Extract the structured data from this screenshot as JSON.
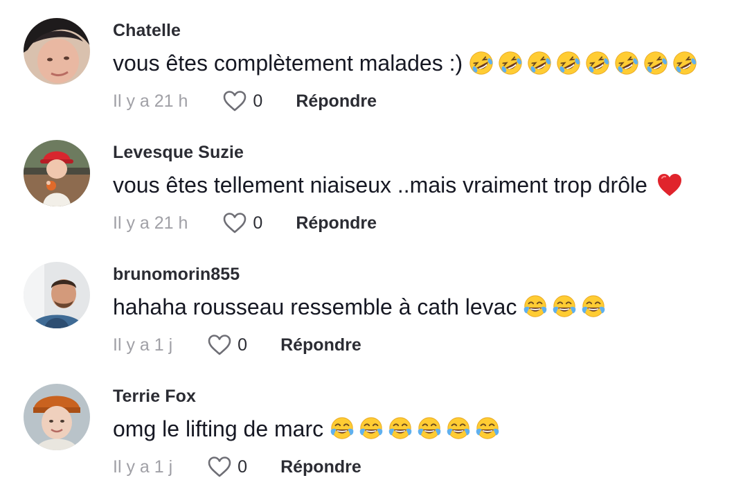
{
  "comments": [
    {
      "username": "Chatelle",
      "text": "vous êtes complètement malades :)",
      "emoji": "rofl-emoji",
      "emoji_count": 8,
      "time": "Il y a 21 h",
      "likes": "0",
      "reply_label": "Répondre"
    },
    {
      "username": "Levesque Suzie",
      "text": "vous êtes tellement niaiseux ..mais vraiment trop drôle",
      "emoji": "red-heart-emoji",
      "emoji_count": 1,
      "time": "Il y a 21 h",
      "likes": "0",
      "reply_label": "Répondre"
    },
    {
      "username": "brunomorin855",
      "text": "hahaha rousseau ressemble à cath levac",
      "emoji": "joy-emoji",
      "emoji_count": 3,
      "time": "Il y a 1 j",
      "likes": "0",
      "reply_label": "Répondre"
    },
    {
      "username": "Terrie Fox",
      "text": "omg le lifting de marc",
      "emoji": "joy-emoji",
      "emoji_count": 6,
      "time": "Il y a 1 j",
      "likes": "0",
      "reply_label": "Répondre"
    }
  ],
  "colors": {
    "text_primary": "#161823",
    "text_secondary": "#a0a0a6",
    "emoji_yellow": "#ffcc33",
    "heart_red": "#e0242c"
  }
}
